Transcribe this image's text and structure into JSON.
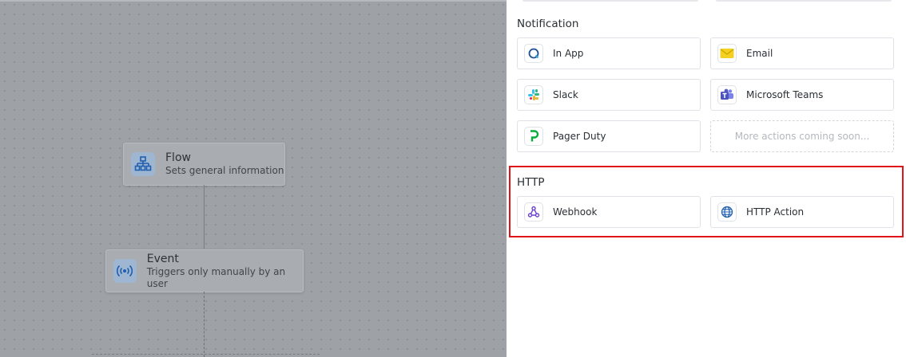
{
  "canvas": {
    "nodes": [
      {
        "title": "Flow",
        "subtitle": "Sets general information",
        "icon": "sitemap-icon"
      },
      {
        "title": "Event",
        "subtitle": "Triggers only manually by an user",
        "icon": "broadcast-icon"
      }
    ]
  },
  "panel": {
    "sections": [
      {
        "title": "Notification",
        "items": [
          {
            "label": "In App",
            "icon": "in-app-icon"
          },
          {
            "label": "Email",
            "icon": "email-icon"
          },
          {
            "label": "Slack",
            "icon": "slack-icon"
          },
          {
            "label": "Microsoft Teams",
            "icon": "teams-icon"
          },
          {
            "label": "Pager Duty",
            "icon": "pagerduty-icon"
          },
          {
            "label": "More actions coming soon...",
            "placeholder": true
          }
        ]
      },
      {
        "title": "HTTP",
        "items": [
          {
            "label": "Webhook",
            "icon": "webhook-icon"
          },
          {
            "label": "HTTP Action",
            "icon": "globe-icon"
          }
        ]
      }
    ]
  },
  "colors": {
    "highlight": "#e0151a",
    "canvas_overlay": "#9ea2a7",
    "accent_blue": "#1f5fae"
  }
}
